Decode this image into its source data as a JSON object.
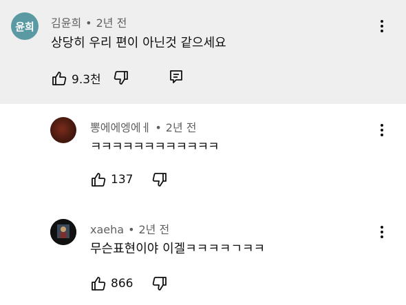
{
  "comments": [
    {
      "author": "김윤희",
      "avatar_text": "윤희",
      "avatar_color": "#5b9aa3",
      "time": "2년 전",
      "text": "상당히 우리 편이 아닌것 같으세요",
      "likes": "9.3천"
    },
    {
      "author": "뽕에에엥에ㅔ",
      "time": "2년 전",
      "text": "ㅋㅋㅋㅋㅋㅋㅋㅋㅋㅋㅋㅋ",
      "likes": "137"
    },
    {
      "author": "xaeha",
      "time": "2년 전",
      "text": "무슨표현이야 이겔ㅋㅋㅋㅋㄱㅋㅋ",
      "likes": "866"
    }
  ],
  "separator": "•",
  "icons": {
    "like": "thumbs-up-icon",
    "dislike": "thumbs-down-icon",
    "reply": "reply-icon",
    "more": "more-vert-icon"
  }
}
